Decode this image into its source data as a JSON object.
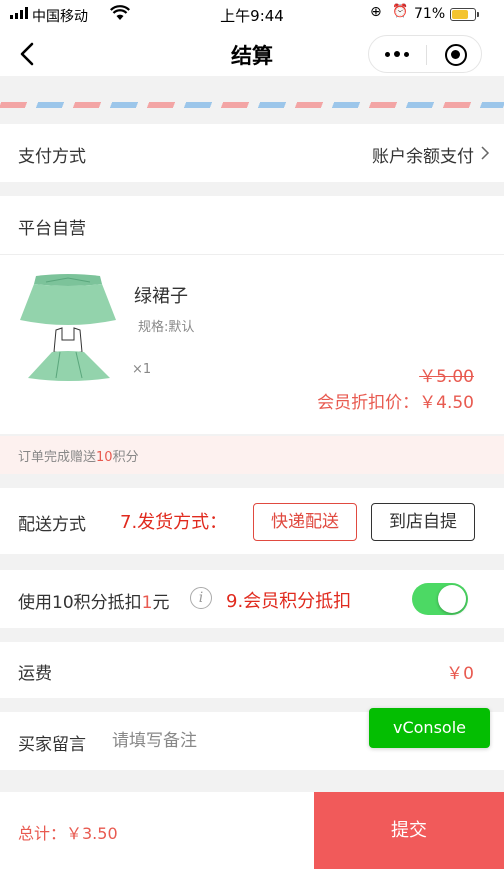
{
  "status_bar": {
    "carrier": "中国移动",
    "time": "上午9:44",
    "battery": "71%",
    "battery_level": 0.71,
    "icons": [
      "signal-icon",
      "wifi-icon",
      "rotation-lock-icon",
      "alarm-icon",
      "battery-icon"
    ]
  },
  "nav": {
    "title": "结算",
    "back_icon": "chevron-left-icon",
    "more_icon": "more-dots-icon",
    "close_icon": "mini-program-close-icon"
  },
  "payment": {
    "label": "支付方式",
    "value": "账户余额支付"
  },
  "shop": {
    "name": "平台自营"
  },
  "product": {
    "name": "绿裙子",
    "spec": "规格:默认",
    "qty": "×1",
    "original_price": "￥5.00",
    "member_price": "会员折扣价：￥4.50"
  },
  "bonus": {
    "prefix": "订单完成赠送",
    "points": "10",
    "suffix": "积分"
  },
  "shipping": {
    "label": "配送方式",
    "annotation": "7.发货方式：",
    "options": [
      "快递配送",
      "到店自提"
    ],
    "selected": "快递配送"
  },
  "points": {
    "prefix": "使用10积分抵扣",
    "amount": "1",
    "suffix": "元",
    "info_glyph": "i",
    "annotation": "9.会员积分抵扣",
    "enabled": true
  },
  "freight": {
    "label": "运费",
    "value": "￥0"
  },
  "note": {
    "label": "买家留言",
    "placeholder": "请填写备注",
    "value": ""
  },
  "vconsole": {
    "label": "vConsole"
  },
  "footer": {
    "total": "总计：￥3.50",
    "submit": "提交"
  },
  "colors": {
    "accent_red": "#e85a50",
    "submit_bg": "#f15a5a",
    "toggle_on": "#4cd964",
    "vconsole_green": "#04be02",
    "annotation_red": "#e02a1e"
  }
}
